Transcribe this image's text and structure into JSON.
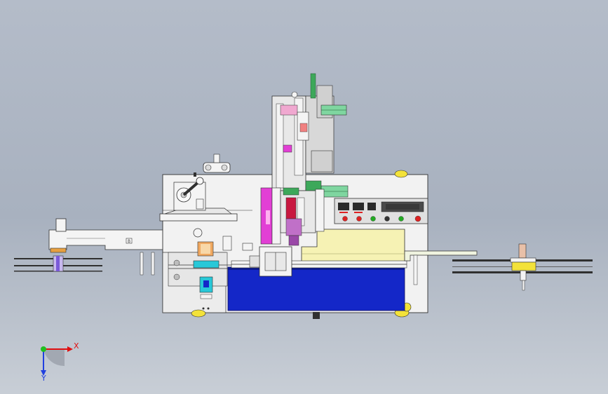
{
  "viewport": {
    "colors": {
      "background_top": "#b4bcc9",
      "background_bottom": "#c8ced6",
      "frame": "#f2f2f2",
      "outline": "#303030",
      "blue_base": "#1427c8",
      "cream_plate": "#f6f2b4",
      "magenta": "#e23fd5",
      "green": "#3da85a",
      "yellow": "#f3e23a",
      "cyan": "#28c8d8",
      "red": "#d8202e",
      "panel_dark": "#2a2a2a"
    }
  },
  "control_panel": {
    "indicator_colors": [
      "#d22",
      "#d22",
      "#2a2",
      "#333",
      "#2a2",
      "#d22"
    ],
    "displays": 3
  },
  "plate_label": "B",
  "triad": {
    "x_label": "X",
    "y_label": "Y",
    "x_color": "#e01010",
    "y_color": "#2040e0",
    "origin_color": "#20c020"
  }
}
